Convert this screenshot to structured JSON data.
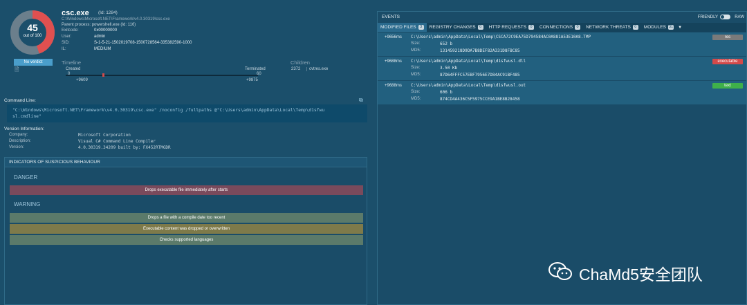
{
  "process": {
    "score": "45",
    "score_sub": "out of 100",
    "score_fraction": 0.45,
    "verdict": "No verdict",
    "name": "csc.exe",
    "id": "(Id: 1284)",
    "path": "C:\\Windows\\Microsoft.NET\\Framework\\v4.0.30319\\csc.exe",
    "parent": "Parent process: powershell.exe (Id: 116)",
    "fields": [
      {
        "k": "Exitcode:",
        "v": "0x00000000"
      },
      {
        "k": "User:",
        "v": "admin"
      },
      {
        "k": "SID:",
        "v": "S-1-5-21-1502019708-1500728564-335382590-1000"
      },
      {
        "k": "IL:",
        "v": "MEDIUM"
      }
    ]
  },
  "timeline": {
    "label": "Timeline",
    "created_label": "Created",
    "created_val": "0",
    "terminated_label": "Terminated",
    "terminated_val": "60",
    "start": "+9609",
    "end": "+9875"
  },
  "children": {
    "label": "Children",
    "pid": "2372",
    "name": "cvtres.exe"
  },
  "command": {
    "label": "Command Line:",
    "line1": "\"C:\\Windows\\Microsoft.NET\\Framework\\v4.0.30319\\csc.exe\" /noconfig /fullpaths @\"C:\\Users\\admin\\AppData\\Local\\Temp\\d1sfwu",
    "line2": "sl.cmdline\""
  },
  "version": {
    "label": "Version Information:",
    "fields": [
      {
        "k": "Company:",
        "v": "Microsoft Corporation"
      },
      {
        "k": "Description:",
        "v": "Visual C# Command Line Compiler"
      },
      {
        "k": "Version:",
        "v": "4.0.30319.34209 built by: FX452RTMGDR"
      }
    ]
  },
  "indicators": {
    "title": "INDICATORS OF SUSPICIOUS BEHAVIOUR",
    "danger_label": "DANGER",
    "warning_label": "WARNING",
    "danger": [
      "Drops executable file immediately after starts"
    ],
    "warning": [
      "Drops a file with a compile date too recent",
      "Executable content was dropped or overwritten",
      "Checks supported languages"
    ],
    "colors": {
      "danger": "#7a4a5c",
      "warning1": "#5b7a6a",
      "warning2": "#7e7a4a",
      "warning3": "#5b7a6a"
    }
  },
  "events": {
    "title": "EVENTS",
    "friendly": "FRIENDLY",
    "raw": "RAW",
    "tabs": [
      {
        "label": "MODIFIED FILES",
        "count": "3"
      },
      {
        "label": "REGISTRY CHANGES",
        "count": "0"
      },
      {
        "label": "HTTP REQUESTS",
        "count": "0"
      },
      {
        "label": "CONNECTIONS",
        "count": "0"
      },
      {
        "label": "NETWORK THREATS",
        "count": "0"
      },
      {
        "label": "MODULES",
        "count": "31"
      }
    ],
    "files": [
      {
        "time": "+9656ms",
        "path": "C:\\Users\\admin\\AppData\\Local\\Temp\\CSCA72C9EA75D794584AC0A881A53E10A8.TMP",
        "size_label": "Size:",
        "size": "652 b",
        "md5_label": "MD5:",
        "md5": "131459218D9DA7B8DEF82A331D8FBC85",
        "type": "res",
        "badge_color": "#7a7a7a"
      },
      {
        "time": "+9688ms",
        "path": "C:\\Users\\admin\\AppData\\Local\\Temp\\d1sfwusl.dll",
        "size_label": "Size:",
        "size": "3.50 Kb",
        "md5_label": "MD5:",
        "md5": "87D64FFFC57EBF7956E7D84AC91BF485",
        "type": "executable",
        "badge_color": "#d44a4a"
      },
      {
        "time": "+9688ms",
        "path": "C:\\Users\\admin\\AppData\\Local\\Temp\\d1sfwusl.out",
        "size_label": "Size:",
        "size": "606 b",
        "md5_label": "MD5:",
        "md5": "874CD4A436C5F5975CCE9A1BE8B28458",
        "type": "text",
        "badge_color": "#3fb04a"
      }
    ]
  },
  "watermark": {
    "text": "ChaMd5安全团队"
  }
}
